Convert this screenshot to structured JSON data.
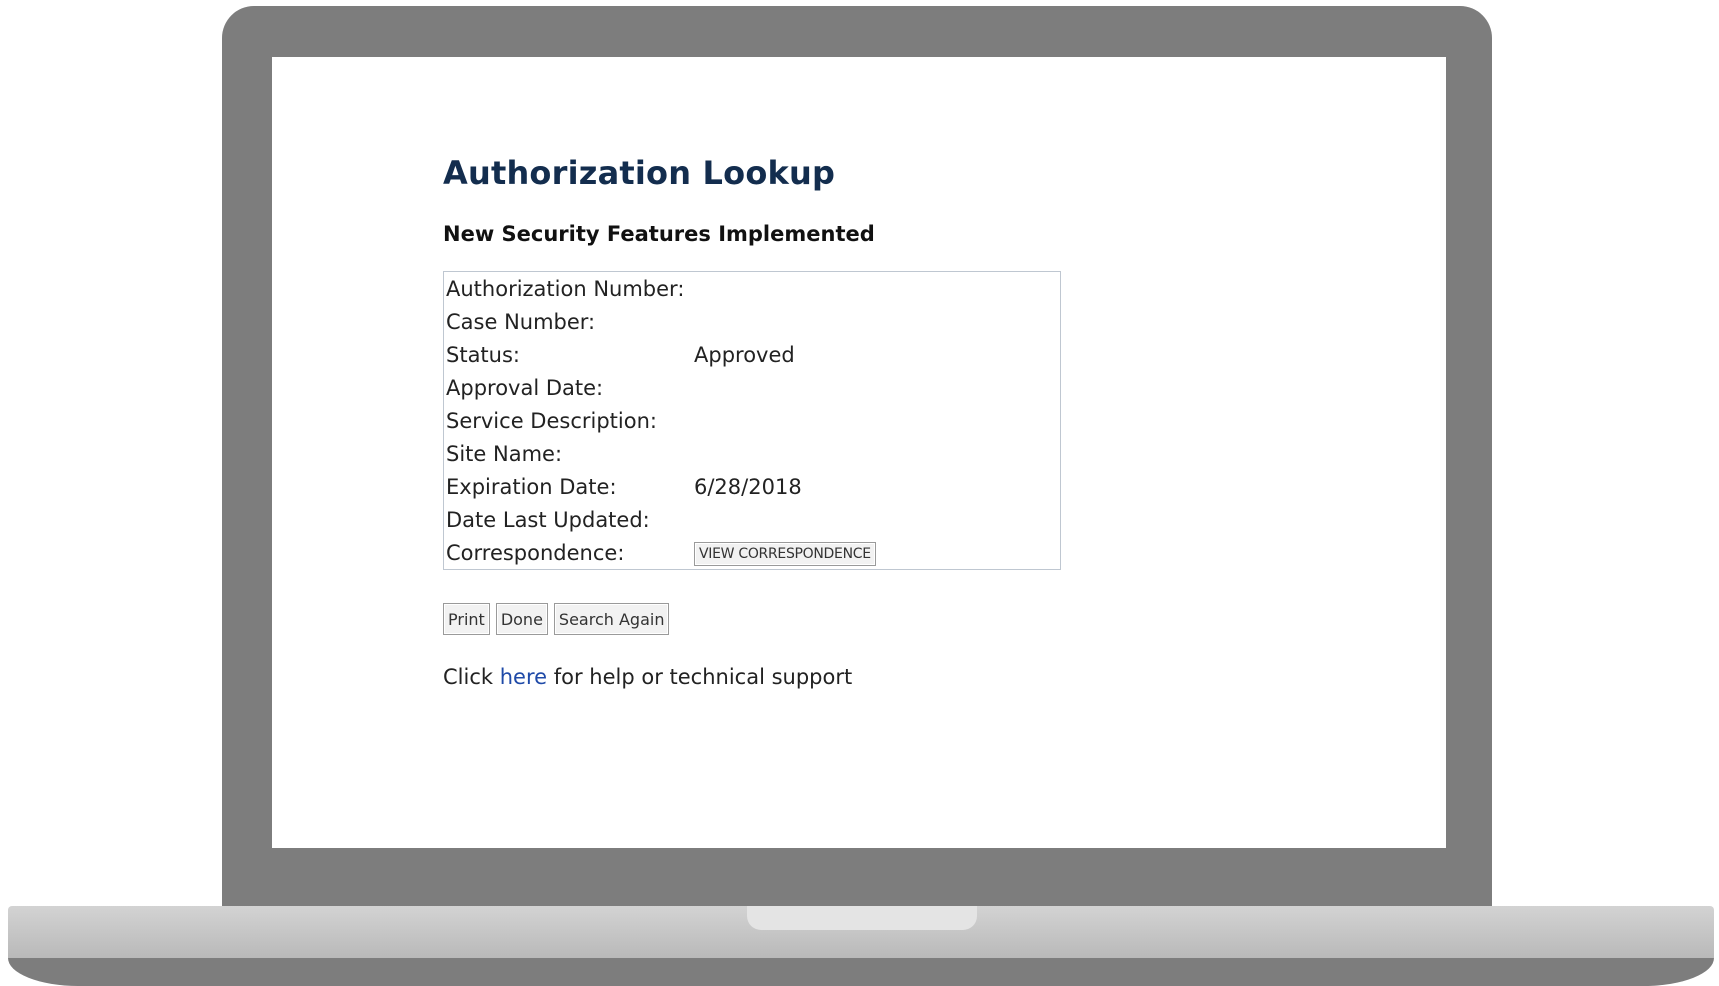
{
  "page": {
    "title": "Authorization Lookup",
    "subtitle": "New Security Features Implemented"
  },
  "details": {
    "rows": [
      {
        "label": "Authorization Number:",
        "value": ""
      },
      {
        "label": "Case Number:",
        "value": ""
      },
      {
        "label": "Status:",
        "value": "Approved"
      },
      {
        "label": "Approval Date:",
        "value": ""
      },
      {
        "label": "Service Description:",
        "value": ""
      },
      {
        "label": "Site Name:",
        "value": ""
      },
      {
        "label": "Expiration Date:",
        "value": "6/28/2018"
      },
      {
        "label": "Date Last Updated:",
        "value": ""
      }
    ],
    "correspondence_label": "Correspondence:",
    "correspondence_button": "VIEW CORRESPONDENCE"
  },
  "actions": {
    "print": "Print",
    "done": "Done",
    "search_again": "Search Again"
  },
  "help": {
    "prefix": "Click",
    "link": "here",
    "suffix": "for help or technical support"
  },
  "colors": {
    "title": "#132d4e",
    "link": "#1f4aa8",
    "frame": "#7d7d7d"
  }
}
